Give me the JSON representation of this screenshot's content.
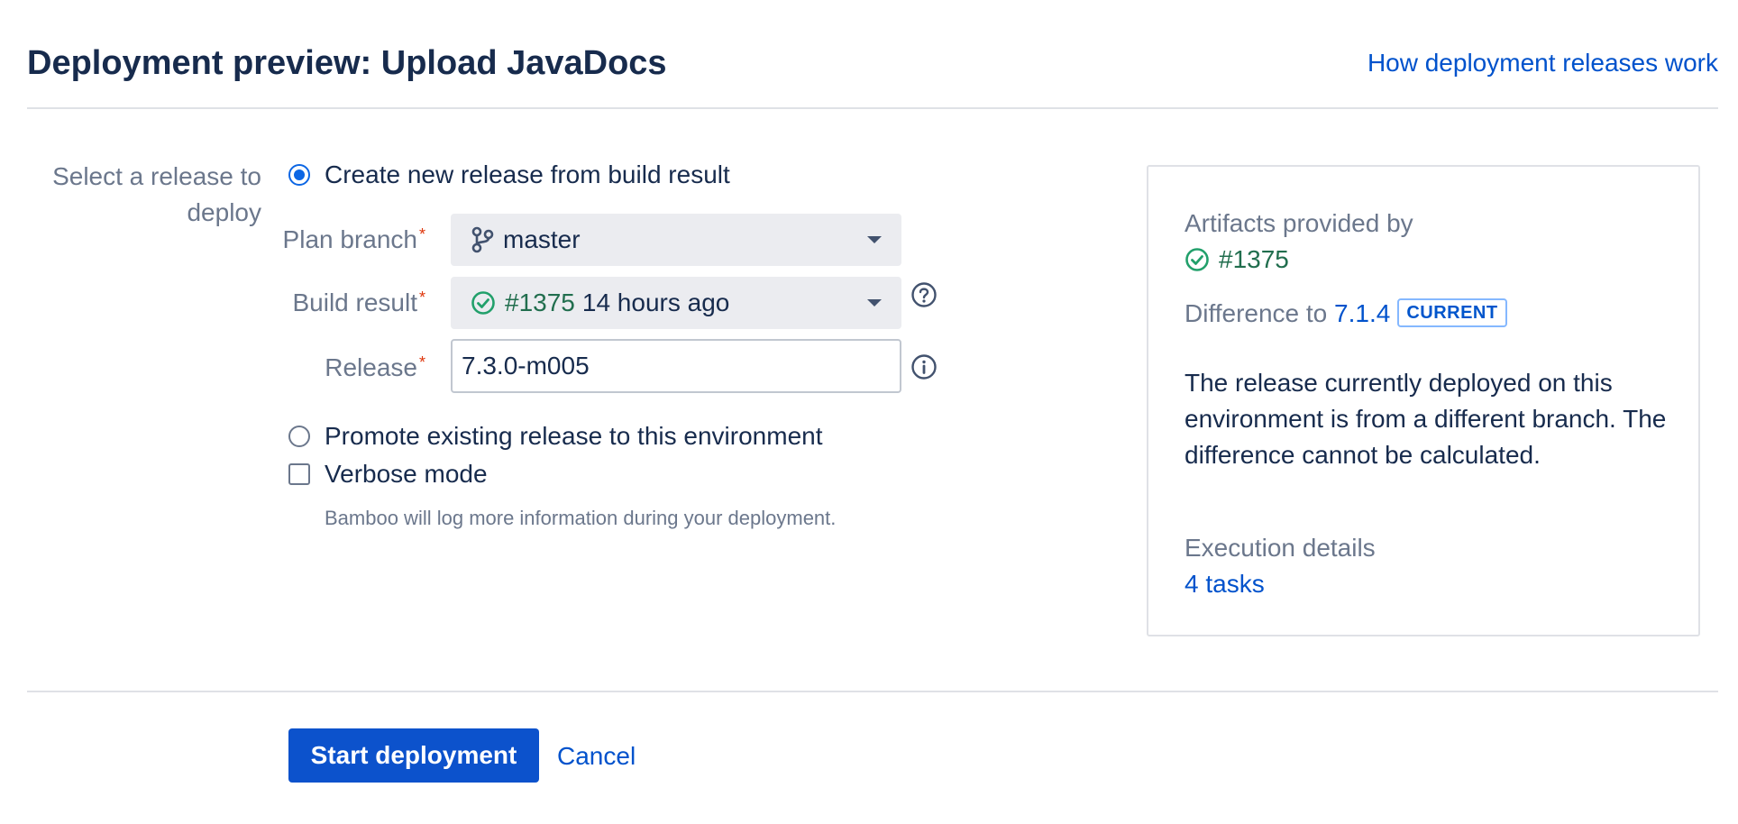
{
  "header": {
    "title": "Deployment preview: Upload JavaDocs",
    "help_link": "How deployment releases work"
  },
  "form": {
    "select_label": "Select a release to deploy",
    "option_create": "Create new release from build result",
    "plan_branch_label": "Plan branch",
    "plan_branch_value": "master",
    "build_result_label": "Build result",
    "build_result_number": "#1375",
    "build_result_time": "14 hours ago",
    "release_label": "Release",
    "release_value": "7.3.0-m005",
    "option_promote": "Promote existing release to this environment",
    "verbose_label": "Verbose mode",
    "verbose_help": "Bamboo will log more information during your deployment.",
    "required_mark": "*"
  },
  "panel": {
    "artifacts_label": "Artifacts provided by",
    "artifacts_build": "#1375",
    "difference_label": "Difference to",
    "difference_version": "7.1.4",
    "current_badge": "CURRENT",
    "difference_message": "The release currently deployed on this environment is from a different branch. The difference cannot be calculated.",
    "execution_label": "Execution details",
    "execution_tasks": "4 tasks"
  },
  "footer": {
    "start_label": "Start deployment",
    "cancel_label": "Cancel"
  },
  "colors": {
    "primary": "#0c52cc",
    "link": "#0052cc",
    "success": "#216e4e",
    "text": "#172b4d",
    "subtle": "#6b778c"
  }
}
